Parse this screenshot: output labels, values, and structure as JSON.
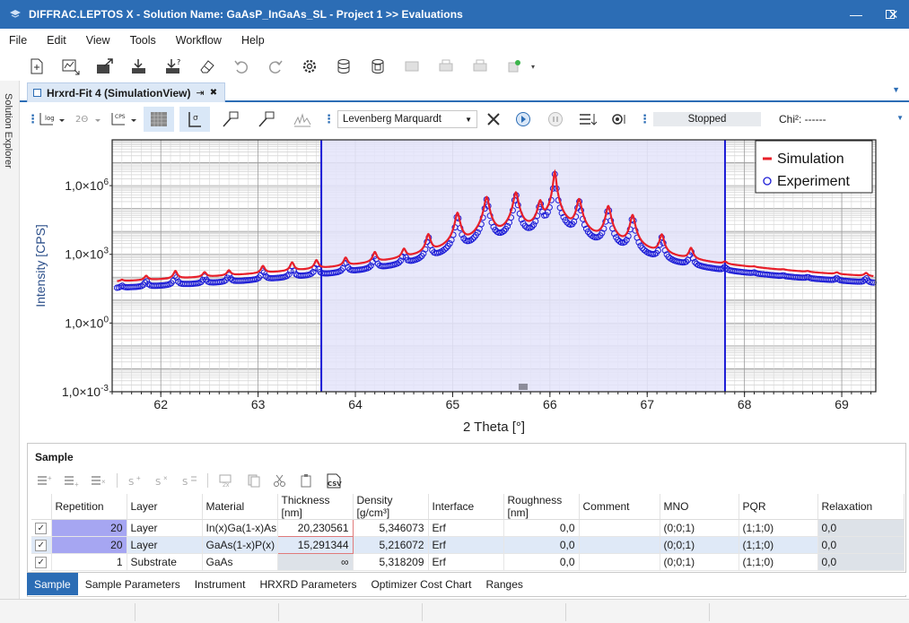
{
  "window": {
    "title": "DIFFRAC.LEPTOS X - Solution Name: GaAsP_InGaAs_SL - Project 1 >> Evaluations",
    "minimize": "—",
    "maximize": "☐",
    "close": "✕"
  },
  "menu": [
    "File",
    "Edit",
    "View",
    "Tools",
    "Workflow",
    "Help"
  ],
  "side_rail": {
    "label": "Solution Explorer"
  },
  "document_tab": {
    "label": "Hrxrd-Fit 4 (SimulationView)",
    "pin": "⇥",
    "close": "✖"
  },
  "chart_toolbar": {
    "log_label": "log",
    "two_theta_label": "2Θ",
    "cps_label": "CPS",
    "algorithm": "Levenberg Marquardt",
    "status": "Stopped",
    "chi_label": "Chi²: ------"
  },
  "chart_data": {
    "type": "line",
    "xlabel": "2 Theta [°]",
    "ylabel": "Intensity [CPS]",
    "x_range": [
      61.5,
      69.35
    ],
    "y_scale": "log",
    "y_range_log10": [
      -3,
      8
    ],
    "x_ticks": [
      "62",
      "63",
      "64",
      "65",
      "66",
      "67",
      "68",
      "69"
    ],
    "y_tick_labels": [
      {
        "mantissa": "1,0×10",
        "exp": "-3",
        "log10": -3
      },
      {
        "mantissa": "1,0×10",
        "exp": "0",
        "log10": 0
      },
      {
        "mantissa": "1,0×10",
        "exp": "3",
        "log10": 3
      },
      {
        "mantissa": "1,0×10",
        "exp": "6",
        "log10": 6
      }
    ],
    "range_selection": [
      63.65,
      67.8
    ],
    "grid": true,
    "legend_position": "top-right",
    "series": [
      {
        "name": "Simulation",
        "style": "line",
        "color": "#e8202a"
      },
      {
        "name": "Experiment",
        "style": "circles",
        "color": "#1b1bd6"
      }
    ],
    "substrate_peak_2theta": 66.05,
    "satellite_peaks_2theta": [
      61.6,
      61.85,
      62.15,
      62.45,
      62.7,
      63.05,
      63.35,
      63.6,
      63.9,
      64.2,
      64.5,
      64.75,
      65.05,
      65.35,
      65.65,
      65.9,
      66.05,
      66.3,
      66.6,
      66.85,
      67.15,
      67.45,
      67.8,
      68.1,
      68.4,
      68.65,
      68.95,
      69.25
    ],
    "satellite_peaks_log10_cps": [
      1.0,
      1.6,
      2.0,
      1.8,
      1.9,
      2.2,
      2.4,
      2.5,
      2.6,
      2.9,
      3.0,
      3.8,
      4.8,
      5.5,
      5.7,
      5.3,
      6.6,
      5.4,
      5.1,
      4.7,
      3.8,
      3.1,
      2.0,
      1.3,
      1.1,
      1.2,
      1.4,
      1.6
    ]
  },
  "sample": {
    "title": "Sample",
    "columns": [
      "Repetition",
      "Layer",
      "Material",
      "Thickness [nm]",
      "Density [g/cm³]",
      "Interface",
      "Roughness [nm]",
      "Comment",
      "MNO",
      "PQR",
      "Relaxation"
    ],
    "rows": [
      {
        "check": "✓",
        "repetition": "20",
        "layer": "Layer",
        "material": "In(x)Ga(1-x)As",
        "thickness": "20,230561",
        "density": "5,346073",
        "interface": "Erf",
        "roughness": "0,0",
        "comment": "",
        "mno": "(0;0;1)",
        "pqr": "(1;1;0)",
        "relaxation": "0,0"
      },
      {
        "check": "✓",
        "repetition": "20",
        "layer": "Layer",
        "material": "GaAs(1-x)P(x)",
        "thickness": "15,291344",
        "density": "5,216072",
        "interface": "Erf",
        "roughness": "0,0",
        "comment": "",
        "mno": "(0;0;1)",
        "pqr": "(1;1;0)",
        "relaxation": "0,0"
      },
      {
        "check": "✓",
        "repetition": "1",
        "layer": "Substrate",
        "material": "GaAs",
        "thickness": "∞",
        "density": "5,318209",
        "interface": "Erf",
        "roughness": "0,0",
        "comment": "",
        "mno": "(0;0;1)",
        "pqr": "(1;1;0)",
        "relaxation": "0,0"
      }
    ]
  },
  "bottom_tabs": [
    "Sample",
    "Sample Parameters",
    "Instrument",
    "HRXRD Parameters",
    "Optimizer Cost Chart",
    "Ranges"
  ],
  "colors": {
    "accent": "#2c6db5",
    "simulation": "#e8202a",
    "experiment": "#1b1bd6",
    "selection": "#e4e4fa",
    "repetition_cell": "#a6a6f2"
  }
}
